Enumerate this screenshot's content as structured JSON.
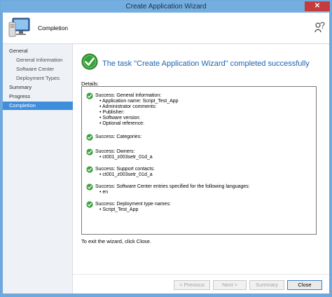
{
  "window": {
    "title": "Create Application Wizard",
    "close_glyph": "✕"
  },
  "header": {
    "title": "Completion"
  },
  "sidebar": {
    "items": [
      {
        "label": "General",
        "level": 0,
        "active": false
      },
      {
        "label": "General Information",
        "level": 1,
        "active": false
      },
      {
        "label": "Software Center",
        "level": 1,
        "active": false
      },
      {
        "label": "Deployment Types",
        "level": 1,
        "active": false
      },
      {
        "label": "Summary",
        "level": 0,
        "active": false
      },
      {
        "label": "Progress",
        "level": 0,
        "active": false
      },
      {
        "label": "Completion",
        "level": 0,
        "active": true
      }
    ]
  },
  "main": {
    "headline": "The task \"Create Application Wizard\" completed successfully",
    "details_label": "Details:",
    "entries": [
      {
        "title": "Success: General Information:",
        "items": [
          "• Application name: Script_Test_App",
          "• Administrator comments:",
          "• Publisher:",
          "• Software version:",
          "• Optional reference:"
        ]
      },
      {
        "title": "Success: Categories:",
        "items": []
      },
      {
        "title": "Success: Owners:",
        "items": [
          "• ct001_z003setr_01d_a"
        ]
      },
      {
        "title": "Success: Support contacts:",
        "items": [
          "• ct001_z003setr_01d_a"
        ]
      },
      {
        "title": "Success: Software Center entries specified for the following languages:",
        "items": [
          "• en"
        ]
      },
      {
        "title": "Success: Deployment type names:",
        "items": [
          "• Script_Test_App"
        ]
      }
    ],
    "exit_text": "To exit the wizard, click Close."
  },
  "buttons": {
    "previous": "< Previous",
    "next": "Next >",
    "summary": "Summary",
    "close": "Close"
  },
  "colors": {
    "accent": "#3f8edb",
    "headline": "#1c63b2",
    "success": "#3aa03a"
  },
  "icons": {
    "header": "computer-icon",
    "help": "help-icon",
    "status": "check-circle-icon"
  }
}
